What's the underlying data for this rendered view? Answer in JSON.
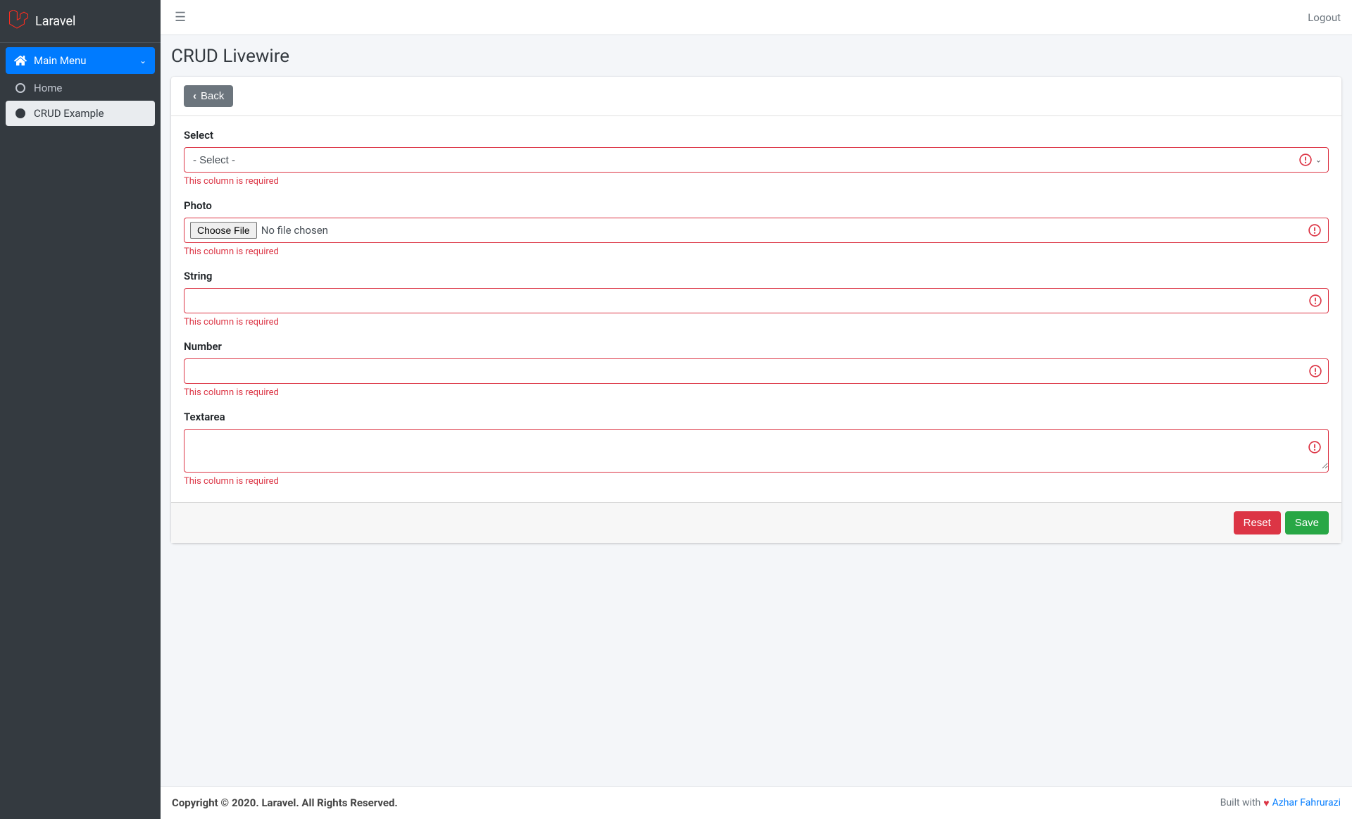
{
  "brand": {
    "text": "Laravel"
  },
  "sidebar": {
    "menu_label": "Main Menu",
    "items": [
      {
        "label": "Home",
        "active": false
      },
      {
        "label": "CRUD Example",
        "active": true
      }
    ]
  },
  "topbar": {
    "logout": "Logout"
  },
  "page": {
    "title": "CRUD Livewire"
  },
  "card": {
    "back_label": "Back",
    "reset_label": "Reset",
    "save_label": "Save"
  },
  "form": {
    "fields": {
      "select": {
        "label": "Select",
        "placeholder": "- Select -",
        "error": "This column is required"
      },
      "photo": {
        "label": "Photo",
        "button": "Choose File",
        "nofile": "No file chosen",
        "error": "This column is required"
      },
      "string": {
        "label": "String",
        "value": "",
        "error": "This column is required"
      },
      "number": {
        "label": "Number",
        "value": "",
        "error": "This column is required"
      },
      "textarea": {
        "label": "Textarea",
        "value": "",
        "error": "This column is required"
      }
    }
  },
  "footer": {
    "copyright": "Copyright © 2020. Laravel. All Rights Reserved.",
    "built_with": "Built with",
    "author": "Azhar Fahrurazi"
  }
}
